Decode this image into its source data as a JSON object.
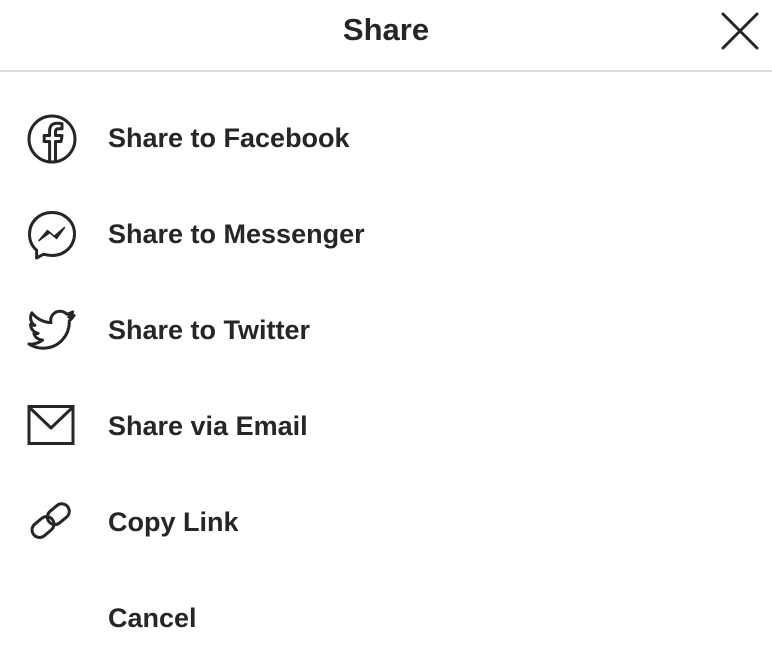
{
  "header": {
    "title": "Share",
    "close_icon": "close-icon"
  },
  "menu": {
    "items": [
      {
        "label": "Share to Facebook",
        "icon": "facebook-icon"
      },
      {
        "label": "Share to Messenger",
        "icon": "messenger-icon"
      },
      {
        "label": "Share to Twitter",
        "icon": "twitter-icon"
      },
      {
        "label": "Share via Email",
        "icon": "email-icon"
      },
      {
        "label": "Copy Link",
        "icon": "link-icon"
      }
    ],
    "cancel_label": "Cancel"
  },
  "colors": {
    "text": "#262626",
    "divider": "#dbdbdb",
    "background": "#ffffff"
  }
}
